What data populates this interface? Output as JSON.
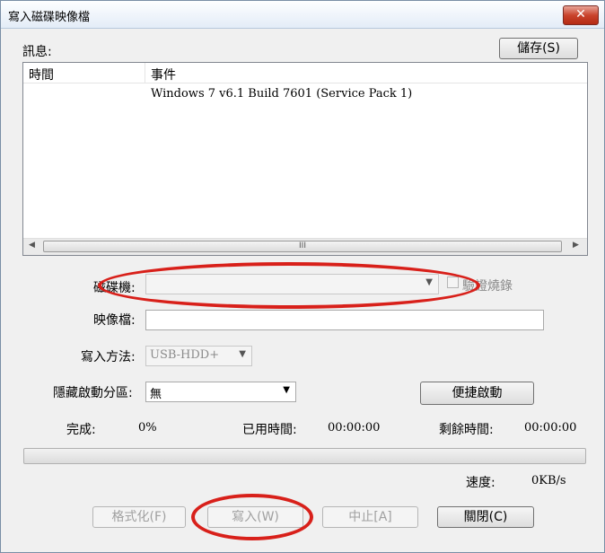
{
  "window": {
    "title": "寫入磁碟映像檔",
    "close_glyph": "✕"
  },
  "messages": {
    "label": "訊息:",
    "save_label": "儲存(S)",
    "columns": [
      "時間",
      "事件"
    ],
    "rows": [
      {
        "time": "",
        "event": "Windows 7 v6.1 Build 7601 (Service Pack 1)"
      }
    ],
    "scroll_grip": "III"
  },
  "form": {
    "drive_label": "磁碟機:",
    "drive_value": "",
    "verify_label": "驗證燒錄",
    "image_label": "映像檔:",
    "image_value": "",
    "method_label": "寫入方法:",
    "method_value": "USB-HDD+",
    "hidden_label": "隱藏啟動分區:",
    "hidden_value": "無",
    "quickboot_label": "便捷啟動"
  },
  "status": {
    "done_label": "完成:",
    "done_value": "0%",
    "elapsed_label": "已用時間:",
    "elapsed_value": "00:00:00",
    "remaining_label": "剩餘時間:",
    "remaining_value": "00:00:00",
    "speed_label": "速度:",
    "speed_value": "0KB/s",
    "progress": 0
  },
  "buttons": {
    "format": "格式化(F)",
    "write": "寫入(W)",
    "abort": "中止[A]",
    "close": "關閉(C)"
  },
  "colors": {
    "annotation": "#d8201a",
    "progress": "#37b54a"
  },
  "icons": {
    "combo": "chevron-down-icon",
    "scroll_left": "arrow-left-icon",
    "scroll_right": "arrow-right-icon"
  }
}
